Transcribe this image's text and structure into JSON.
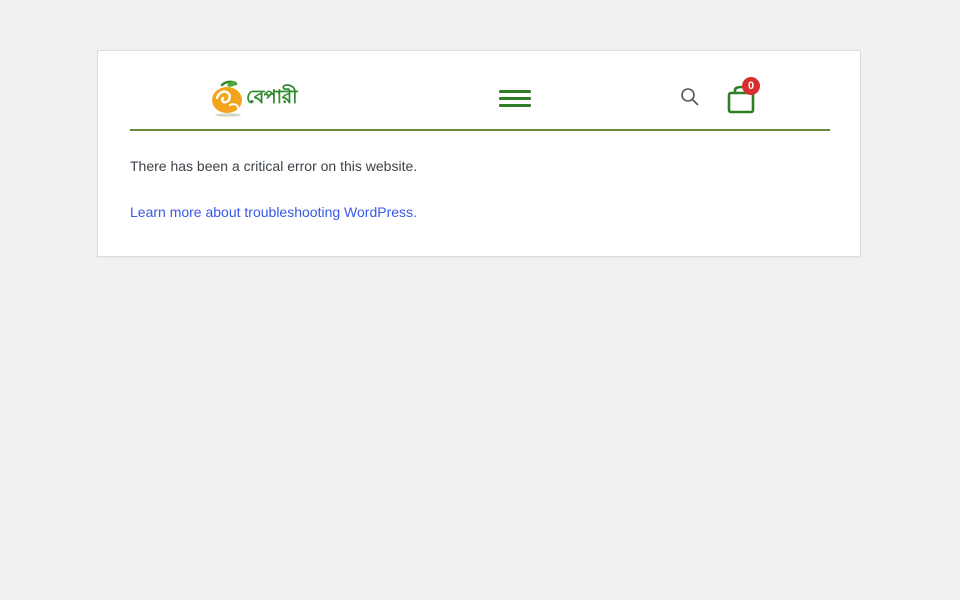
{
  "header": {
    "logo_text": "বেপারী",
    "cart_count": "0"
  },
  "message": {
    "error_text": "There has been a critical error on this website.",
    "help_link_text": "Learn more about troubleshooting WordPress."
  },
  "colors": {
    "brand_green": "#2f7d26",
    "divider_green": "#6a8a3a",
    "logo_orange": "#f2a41c",
    "badge_red": "#d72f2f",
    "link_blue": "#3858e9"
  },
  "icons": {
    "logo": "mango-logo-icon",
    "menu": "hamburger-menu-icon",
    "search": "search-icon",
    "cart": "shopping-bag-icon"
  }
}
